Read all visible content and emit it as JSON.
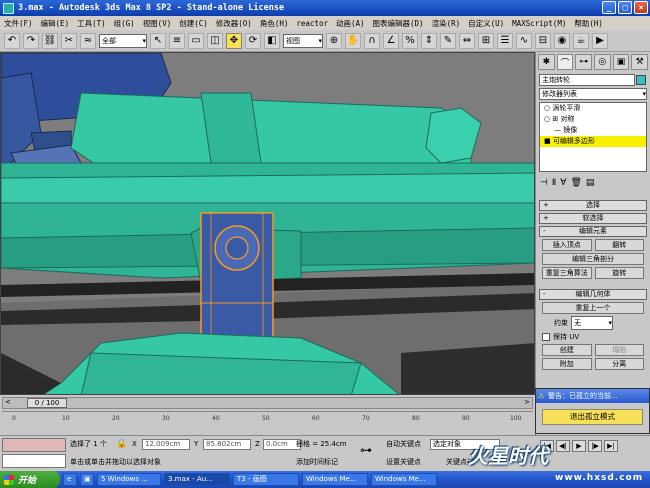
{
  "window": {
    "title": "3.max - Autodesk 3ds Max 8 SP2 - Stand-alone License"
  },
  "menu": [
    "文件(F)",
    "编辑(E)",
    "工具(T)",
    "组(G)",
    "视图(V)",
    "创建(C)",
    "修改器(O)",
    "角色(H)",
    "reactor",
    "动画(A)",
    "图表编辑器(D)",
    "渲染(R)",
    "自定义(U)",
    "MAXScript(M)",
    "帮助(H)"
  ],
  "toolbar": {
    "selection_filter": "全部",
    "coordinate_system": "视图"
  },
  "command_panel": {
    "object_name": "主炮转轮",
    "modifier_list": "修改器列表",
    "stack": [
      {
        "label": "涡轮平滑",
        "selected": false
      },
      {
        "label": "对称",
        "selected": false
      },
      {
        "label": "镜像",
        "selected": false
      },
      {
        "label": "可编辑多边形",
        "selected": true
      }
    ],
    "rollouts": {
      "selection": "选择",
      "soft_selection": "软选择",
      "edit_elements": "编辑元素",
      "edit_geometry": "编辑几何体"
    },
    "buttons": {
      "insert_vertex": "插入顶点",
      "flip": "翻转",
      "edit_triangulation": "编辑三角剖分",
      "retriangulate": "重复三角算法",
      "turn": "旋转",
      "repeat_last": "重复上一个",
      "create": "创建",
      "collapse": "塌陷",
      "attach": "附加",
      "detach": "分离"
    },
    "constraint_label": "约束",
    "constraint_value": "无",
    "preserve_uv": "保持 UV"
  },
  "warning": {
    "title": "警告：已孤立的当前...",
    "button": "退出孤立模式"
  },
  "timeline": {
    "slider": "0 / 100",
    "ticks": [
      "0",
      "10",
      "20",
      "30",
      "40",
      "50",
      "60",
      "70",
      "80",
      "90",
      "100"
    ]
  },
  "status": {
    "selected": "选择了 1 个",
    "hint": "单击或单击并拖动以选择对象",
    "x_label": "X",
    "x_value": "12.009cm",
    "y_label": "Y",
    "y_value": "85.802cm",
    "z_label": "Z",
    "z_value": "0.0cm",
    "grid": "栅格 = 25.4cm",
    "add_time_tag": "添加时间标记",
    "auto_key": "自动关键点",
    "set_key": "设置关键点",
    "selected_object": "选定对象",
    "key_filter": "关键点过"
  },
  "taskbar": {
    "start": "开始",
    "tasks": [
      "5 Windows ...",
      "3.max - Au...",
      "T3 - 画图",
      "Windows Me...",
      "Windows Me..."
    ]
  },
  "watermark": {
    "brand": "火星时代",
    "url": "www.hxsd.com"
  }
}
